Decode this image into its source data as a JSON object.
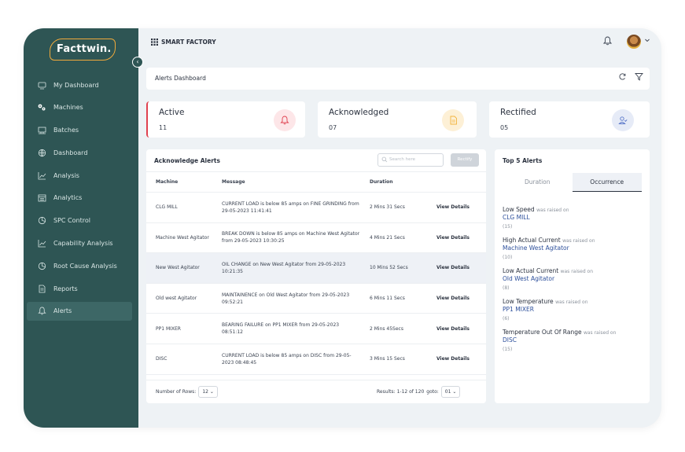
{
  "app": {
    "logo": "Facttwin.",
    "brand": "SMART FACTORY"
  },
  "sidebar": {
    "items": [
      {
        "label": "My Dashboard",
        "icon": "dashboard-icon"
      },
      {
        "label": "Machines",
        "icon": "gears-icon"
      },
      {
        "label": "Batches",
        "icon": "batches-icon"
      },
      {
        "label": "Dashboard",
        "icon": "globe-icon"
      },
      {
        "label": "Analysis",
        "icon": "line-chart-icon"
      },
      {
        "label": "Analytics",
        "icon": "calendar-icon"
      },
      {
        "label": "SPC Control",
        "icon": "pie-chart-icon"
      },
      {
        "label": "Capability Analysis",
        "icon": "line-chart-icon"
      },
      {
        "label": "Root Cause Analysis",
        "icon": "pie-chart-icon"
      },
      {
        "label": "Reports",
        "icon": "document-icon"
      },
      {
        "label": "Alerts",
        "icon": "bell-icon",
        "active": true
      }
    ]
  },
  "breadcrumb": {
    "title": "Alerts Dashboard"
  },
  "stats": {
    "active": {
      "label": "Active",
      "value": "11",
      "color": "#e0414f"
    },
    "acknowledged": {
      "label": "Acknowledged",
      "value": "07",
      "color": "#f2b33d"
    },
    "rectified": {
      "label": "Rectified",
      "value": "05",
      "color": "#5a77c9"
    }
  },
  "ack": {
    "title": "Acknowledge Alerts",
    "search_placeholder": "Search here",
    "rectify_label": "Rectify",
    "columns": [
      "Machine",
      "Message",
      "Duration",
      ""
    ],
    "rows": [
      {
        "machine": "CLG MILL",
        "message": "CURRENT LOAD is below 85 amps on FINE GRINDING from 29-05-2023 11:41:41",
        "duration": "2 Mins 31 Secs",
        "action": "View Details"
      },
      {
        "machine": "Machine West Agitator",
        "message": "BREAK DOWN is below 85 amps on Machine West Agitator from 29-05-2023 10:30:25",
        "duration": "4 Mins 21 Secs",
        "action": "View Details"
      },
      {
        "machine": "New West Agitator",
        "message": "OIL CHANGE on New West Agitator from 29-05-2023 10:21:35",
        "duration": "10 Mins 52 Secs",
        "action": "View Details",
        "highlight": true
      },
      {
        "machine": "Old west Agitator",
        "message": "MAINTAINENCE on Old West Agitator from 29-05-2023 09:52:21",
        "duration": "6 Mins 11 Secs",
        "action": "View Details"
      },
      {
        "machine": "PP1 MIXER",
        "message": "BEARING FAILURE on PP1 MIXER from 29-05-2023 08:51:12",
        "duration": "2 Mins 45Secs",
        "action": "View Details"
      },
      {
        "machine": "DISC",
        "message": "CURRENT LOAD is below 85 amps on DISC from 29-05-2023 08:48:45",
        "duration": "3 Mins 15 Secs",
        "action": "View Details"
      }
    ],
    "footer": {
      "rows_label": "Number of Rows:",
      "rows_value": "12",
      "results": "Results: 1-12 of 120",
      "goto_label": "goto:",
      "goto_value": "01"
    }
  },
  "top5": {
    "title": "Top 5 Alerts",
    "tabs": [
      "Duration",
      "Occurrence"
    ],
    "raised_text": "was raised on",
    "items": [
      {
        "alert": "Low Speed",
        "machine": "CLG MILL",
        "count": "(15)"
      },
      {
        "alert": "High Actual Current",
        "machine": "Machine West Agitator",
        "count": "(10)"
      },
      {
        "alert": "Low Actual Current",
        "machine": "Old West Agitator",
        "count": "(8)"
      },
      {
        "alert": "Low Temperature",
        "machine": "PP1 MIXER",
        "count": "(6)"
      },
      {
        "alert": "Temperature Out Of Range",
        "machine": "DISC",
        "count": "(15)"
      }
    ]
  }
}
